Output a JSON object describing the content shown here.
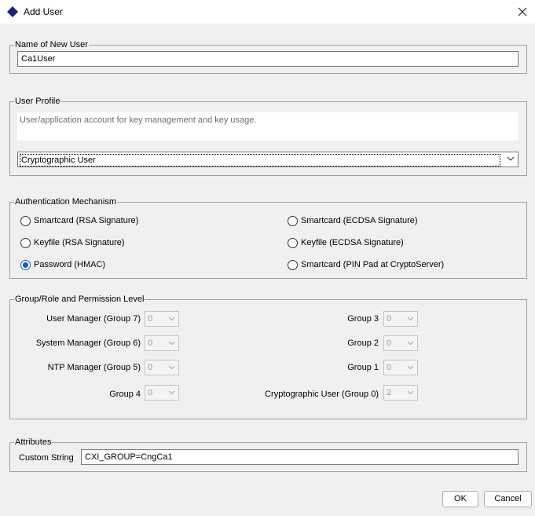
{
  "window": {
    "title": "Add User",
    "icon": "diamond-icon",
    "close_icon": "close-icon",
    "accent": "#1f1f7a"
  },
  "name_section": {
    "legend": "Name of New User",
    "value": "Ca1User"
  },
  "profile_section": {
    "legend": "User Profile",
    "description": "User/application account for key management and key usage.",
    "selected": "Cryptographic User"
  },
  "auth_section": {
    "legend": "Authentication Mechanism",
    "selected_color": "#0a5fc4",
    "options": [
      {
        "label": "Smartcard (RSA Signature)",
        "selected": false
      },
      {
        "label": "Smartcard (ECDSA Signature)",
        "selected": false
      },
      {
        "label": "Keyfile (RSA Signature)",
        "selected": false
      },
      {
        "label": "Keyfile (ECDSA Signature)",
        "selected": false
      },
      {
        "label": "Password (HMAC)",
        "selected": true
      },
      {
        "label": "Smartcard (PIN Pad at CryptoServer)",
        "selected": false
      }
    ]
  },
  "perm_section": {
    "legend": "Group/Role and Permission Level",
    "fields": [
      {
        "label": "User Manager (Group 7)",
        "value": "0"
      },
      {
        "label": "Group 3",
        "value": "0"
      },
      {
        "label": "System Manager (Group 6)",
        "value": "0"
      },
      {
        "label": "Group 2",
        "value": "0"
      },
      {
        "label": "NTP Manager (Group 5)",
        "value": "0"
      },
      {
        "label": "Group 1",
        "value": "0"
      },
      {
        "label": "Group 4",
        "value": "0"
      },
      {
        "label": "Cryptographic User (Group 0)",
        "value": "2"
      }
    ]
  },
  "attr_section": {
    "legend": "Attributes",
    "custom_label": "Custom String",
    "custom_value": "CXI_GROUP=CngCa1"
  },
  "buttons": {
    "ok": "OK",
    "cancel": "Cancel"
  }
}
